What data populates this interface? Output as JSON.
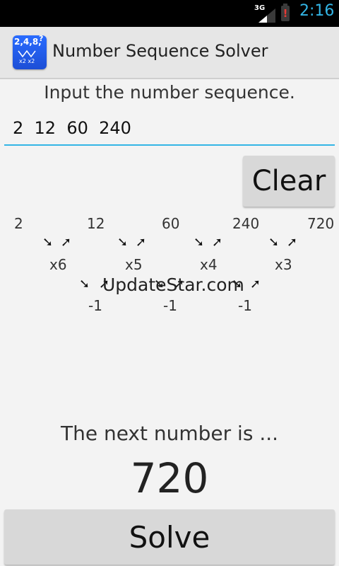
{
  "status_bar": {
    "network": "3G",
    "time": "2:16"
  },
  "app": {
    "title": "Number Sequence Solver",
    "icon_text": "2,4,8,",
    "icon_question": "?",
    "icon_sub": "x2 x2"
  },
  "prompt": "Input the number sequence.",
  "input": {
    "value": "2  12  60  240"
  },
  "clear_label": "Clear",
  "diagram": {
    "terms": [
      "2",
      "12",
      "60",
      "240",
      "720"
    ],
    "ratios": [
      "x6",
      "x5",
      "x4",
      "x3"
    ],
    "diffs": [
      "-1",
      "-1",
      "-1"
    ],
    "arrow_down": "➘",
    "arrow_up": "➚"
  },
  "watermark": "UpdateStar.com",
  "result": {
    "label": "The next number is ...",
    "value": "720"
  },
  "solve_label": "Solve",
  "colors": {
    "accent": "#33b5e5",
    "battery_alert": "#e53935",
    "icon_blue": "#1c4ed6"
  }
}
